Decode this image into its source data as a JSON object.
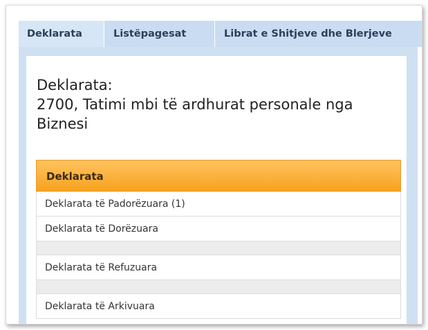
{
  "tabs": [
    {
      "label": "Deklarata"
    },
    {
      "label": "Listëpagesat"
    },
    {
      "label": "Librat e Shitjeve dhe Blerjeve"
    }
  ],
  "heading": {
    "line1": "Deklarata:",
    "line2": "2700, Tatimi mbi të ardhurat personale nga",
    "line3": "Biznesi"
  },
  "group": {
    "title": "Deklarata",
    "items": [
      {
        "label": "Deklarata të Padorëzuara (1)"
      },
      {
        "label": "Deklarata të Dorëzuara"
      },
      {
        "label": "Deklarata të Refuzuara"
      },
      {
        "label": "Deklarata të Arkivuara"
      }
    ]
  },
  "colors": {
    "tab_bg": "#c9dcf1",
    "header_orange": "#f7a21f",
    "panel_bg": "#cfe0f2"
  }
}
